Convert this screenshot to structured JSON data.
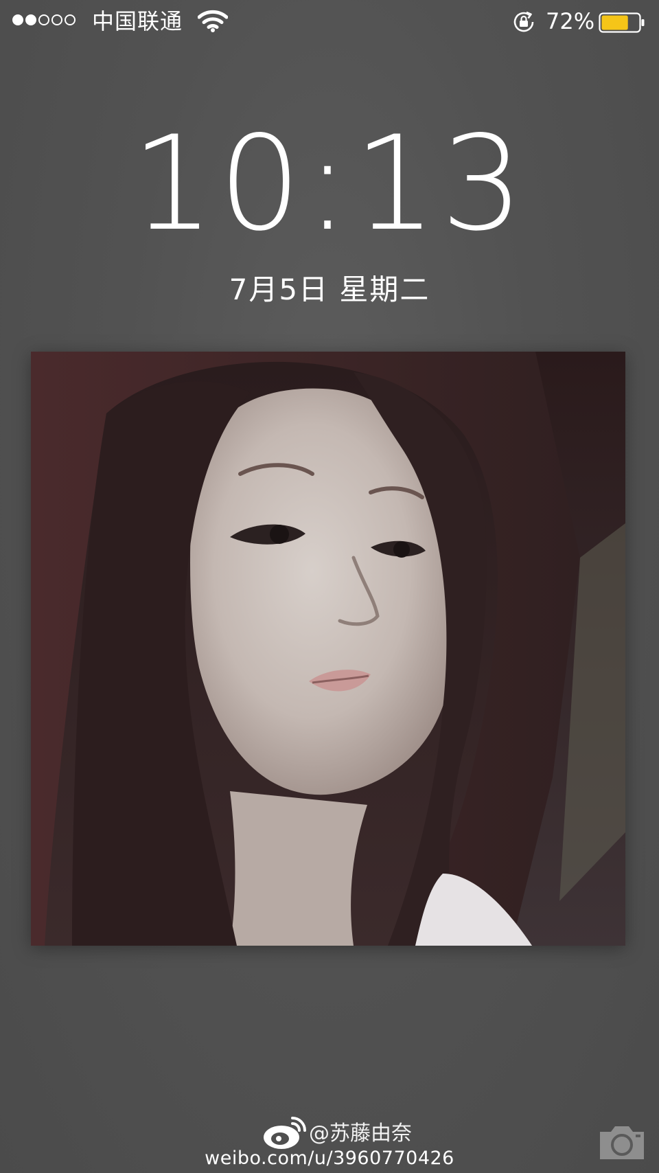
{
  "status_bar": {
    "signal_bars_filled": 2,
    "signal_bars_total": 5,
    "carrier": "中国联通",
    "wifi_icon": "wifi-icon",
    "orientation_lock_icon": "orientation-lock-icon",
    "battery_percent": "72%",
    "battery_level": 0.72,
    "battery_color": "#f5c518"
  },
  "lock_screen": {
    "time": "10:13",
    "date": "7月5日 星期二"
  },
  "photo": {
    "description_icon": "photo-notification"
  },
  "footer": {
    "weibo_icon": "weibo-icon",
    "handle": "@苏藤由奈",
    "url": "weibo.com/u/3960770426",
    "camera_icon": "camera-icon"
  }
}
